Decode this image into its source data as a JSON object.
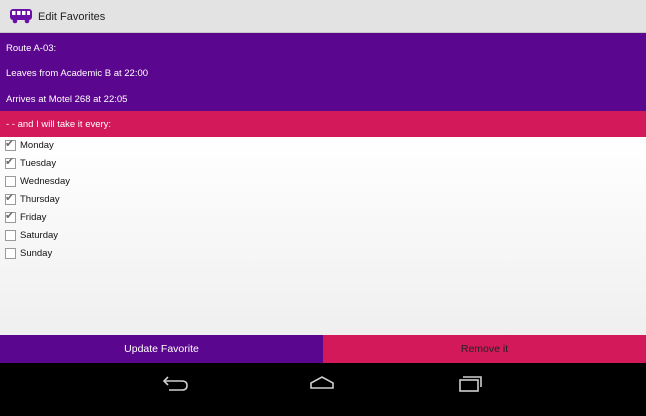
{
  "actionbar": {
    "title": "Edit Favorites",
    "icon": "bus-icon"
  },
  "route": {
    "name": "Route A-03:",
    "departs": "Leaves from Academic B at 22:00",
    "arrives": "Arrives at Motel 268 at 22:05"
  },
  "subheader": " - - and I will take it every:",
  "days": [
    {
      "label": "Monday",
      "checked": true
    },
    {
      "label": "Tuesday",
      "checked": true
    },
    {
      "label": "Wednesday",
      "checked": false
    },
    {
      "label": "Thursday",
      "checked": true
    },
    {
      "label": "Friday",
      "checked": true
    },
    {
      "label": "Saturday",
      "checked": false
    },
    {
      "label": "Sunday",
      "checked": false
    }
  ],
  "buttons": {
    "update": "Update Favorite",
    "remove": "Remove it"
  },
  "colors": {
    "primary": "#5b068e",
    "accent": "#d4195a",
    "actionbar": "#e3e3e3"
  },
  "navbar": {
    "icons": [
      "back-icon",
      "home-icon",
      "recents-icon"
    ]
  }
}
